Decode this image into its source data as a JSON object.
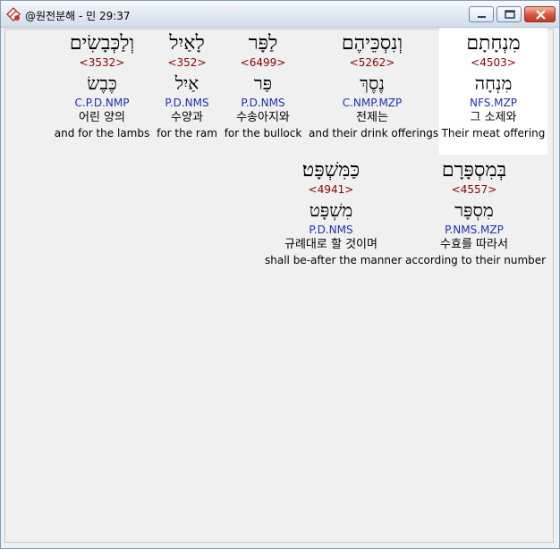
{
  "window": {
    "title": "@원전분해 - 민 29:37",
    "icon": "app-logo-icon",
    "controls": [
      "minimize-icon",
      "maximize-icon",
      "close-icon"
    ]
  },
  "row1": [
    {
      "hebrew": "מִנְחָתָם",
      "strong": "<4503>",
      "lemma": "מִנְחָה",
      "parse": "NFS.MZP",
      "korean": "그 소제와",
      "english": "Their meat offering"
    },
    {
      "hebrew": "וְנִסְכֵּיהֶם",
      "strong": "<5262>",
      "lemma": "נֶסֶךְ",
      "parse": "C.NMP.MZP",
      "korean": "전제는",
      "english": "and their drink offerings"
    },
    {
      "hebrew": "לַפָּר",
      "strong": "<6499>",
      "lemma": "פַּר",
      "parse": "P.D.NMS",
      "korean": "수송아지와",
      "english": "for the bullock"
    },
    {
      "hebrew": "לָאַיִל",
      "strong": "<352>",
      "lemma": "אַיִל",
      "parse": "P.D.NMS",
      "korean": "수양과",
      "english": "for the ram"
    },
    {
      "hebrew": "וְלַכְּבָשִׂים",
      "strong": "<3532>",
      "lemma": "כֶּבֶשׂ",
      "parse": "C.P.D.NMP",
      "korean": "어린 양의",
      "english": "and for the lambs"
    }
  ],
  "row2": [
    {
      "hebrew": "בְּמִסְפָּרָם",
      "strong": "<4557>",
      "lemma": "מִסְפָּר",
      "parse": "P.NMS.MZP",
      "korean": "수효를 따라서",
      "english": "according to their number"
    },
    {
      "hebrew": "כַּמִּשְׁפָּט׃",
      "strong": "<4941>",
      "lemma": "מִשְׁפָּט",
      "parse": "P.D.NMS",
      "korean": "규례대로 할 것이며",
      "english": "shall be-after the manner"
    }
  ]
}
